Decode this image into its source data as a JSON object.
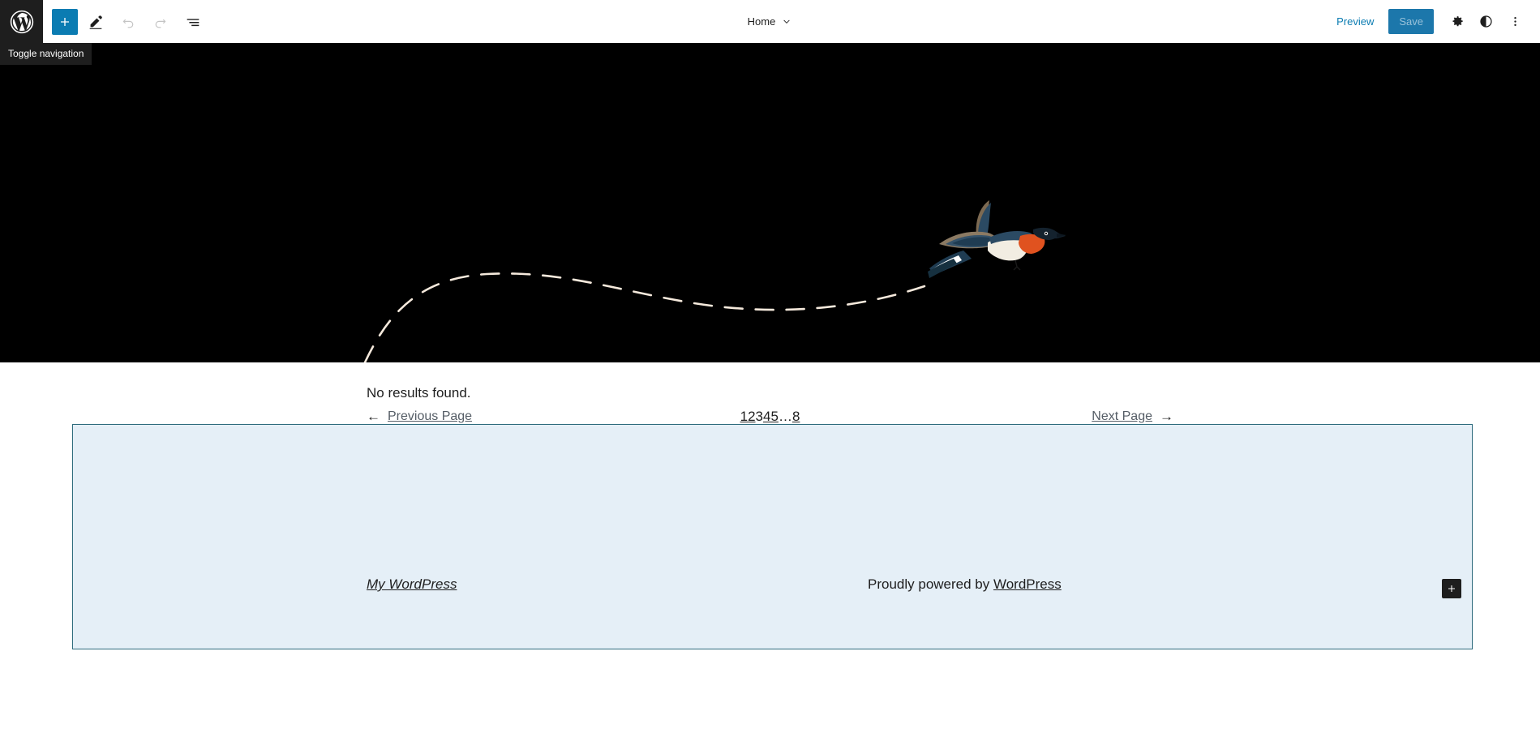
{
  "topbar": {
    "logo_icon": "wordpress-logo-icon",
    "tooltip": "Toggle navigation",
    "add_block_icon": "plus-icon",
    "add_block_label": "Add block",
    "edit_icon": "pencil-icon",
    "edit_label": "Edit",
    "undo_icon": "undo-arrow-icon",
    "undo_label": "Undo",
    "redo_icon": "redo-arrow-icon",
    "redo_label": "Redo",
    "list_view_icon": "list-view-icon",
    "list_view_label": "List View",
    "document_title": "Home",
    "chevron_icon": "chevron-down-icon",
    "preview_label": "Preview",
    "save_label": "Save",
    "settings_icon": "gear-icon",
    "settings_label": "Settings",
    "styles_icon": "contrast-half-circle-icon",
    "styles_label": "Styles",
    "options_icon": "three-dots-vertical-icon",
    "options_label": "Options"
  },
  "hero": {
    "background_color": "#000000",
    "path_color": "#f5e9dc",
    "bird_alt": "flying-swallow-illustration"
  },
  "content": {
    "no_results": "No results found.",
    "pagination": {
      "previous_arrow": "arrow-left-icon",
      "previous_label": "Previous Page",
      "pages": [
        {
          "label": "1",
          "current": false
        },
        {
          "label": "2",
          "current": false
        },
        {
          "label": "3",
          "current": true
        },
        {
          "label": "4",
          "current": false
        },
        {
          "label": "5",
          "current": false
        },
        {
          "label": "…",
          "current": false,
          "ellipsis": true
        },
        {
          "label": "8",
          "current": false
        }
      ],
      "next_label": "Next Page",
      "next_arrow": "arrow-right-icon"
    }
  },
  "footer": {
    "selected": true,
    "selection_border_color": "#2e6b7d",
    "background_color": "#e5eff7",
    "site_title": "My WordPress",
    "credit_prefix": "Proudly powered by ",
    "credit_link": "WordPress"
  },
  "bottom_bar": {
    "inserter_icon": "plus-icon",
    "inserter_label": "Add block"
  }
}
